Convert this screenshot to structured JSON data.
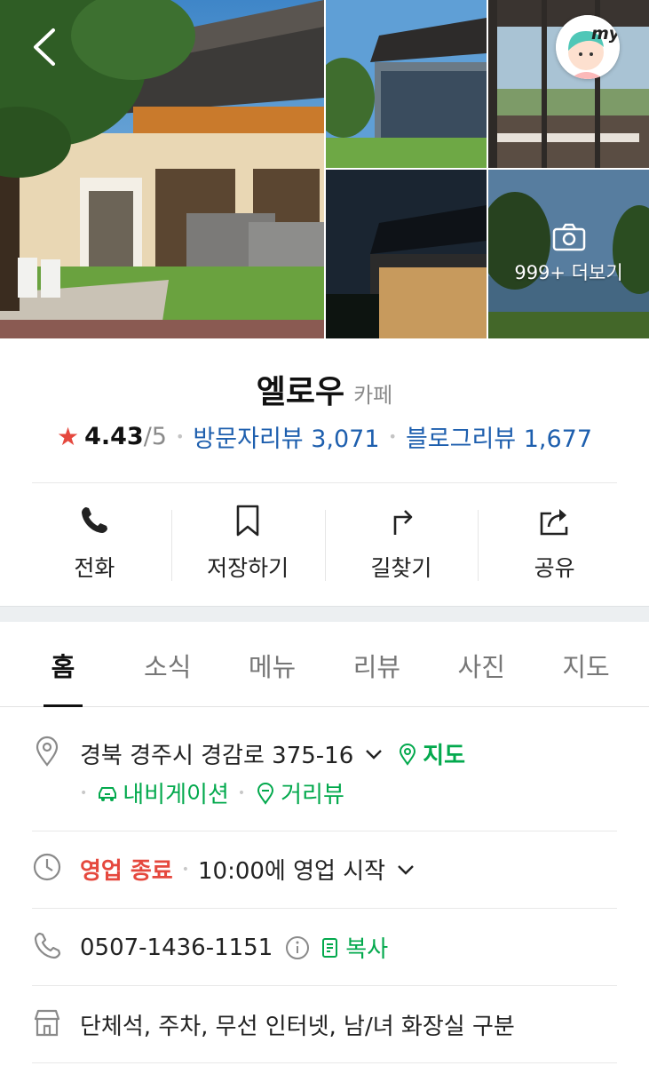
{
  "gallery": {
    "more_label": "999+ 더보기",
    "my_badge": "my"
  },
  "place": {
    "name": "엘로우",
    "category": "카페",
    "rating": "4.43",
    "rating_max": "/5",
    "visitor_reviews": "방문자리뷰 3,071",
    "blog_reviews": "블로그리뷰 1,677"
  },
  "actions": [
    {
      "label": "전화",
      "icon": "phone-icon"
    },
    {
      "label": "저장하기",
      "icon": "bookmark-icon"
    },
    {
      "label": "길찾기",
      "icon": "directions-icon"
    },
    {
      "label": "공유",
      "icon": "share-icon"
    }
  ],
  "tabs": [
    {
      "label": "홈",
      "active": true
    },
    {
      "label": "소식"
    },
    {
      "label": "메뉴"
    },
    {
      "label": "리뷰"
    },
    {
      "label": "사진"
    },
    {
      "label": "지도"
    }
  ],
  "info": {
    "address": "경북 경주시 경감로 375-16",
    "map_link": "지도",
    "navigation_link": "내비게이션",
    "streetview_link": "거리뷰",
    "status": "영업 종료",
    "hours": "10:00에 영업 시작",
    "phone": "0507-1436-1151",
    "copy_link": "복사",
    "amenities": "단체석, 주차, 무선 인터넷, 남/녀 화장실 구분"
  },
  "colors": {
    "accent_green": "#03a94d",
    "status_red": "#e5483e",
    "review_blue": "#1e5fae",
    "star": "#e5483e"
  }
}
